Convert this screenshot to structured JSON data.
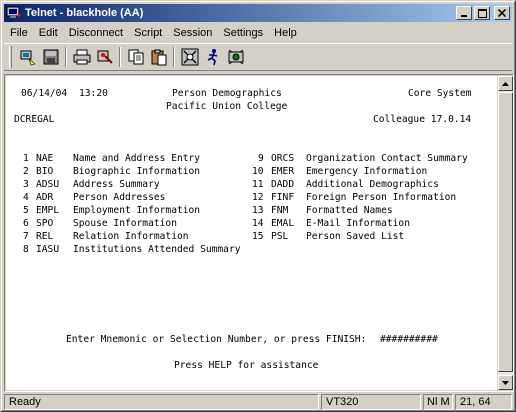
{
  "window": {
    "title": "Telnet - blackhole (AA)"
  },
  "menu": [
    "File",
    "Edit",
    "Disconnect",
    "Script",
    "Session",
    "Settings",
    "Help"
  ],
  "toolbar": {
    "icons": [
      "connect-icon",
      "save-icon",
      "print-icon",
      "color-icon",
      "copy-icon",
      "paste-icon",
      "network-icon",
      "run-icon",
      "macro-icon"
    ]
  },
  "terminal": {
    "header": {
      "date": "06/14/04",
      "time": "13:20",
      "title": "Person Demographics",
      "institution": "Pacific Union College",
      "system": "Core System",
      "screen_code": "DCREGAL",
      "version": "Colleague 17.0.14"
    },
    "options_left": [
      {
        "num": "1",
        "code": "NAE",
        "label": "Name and Address Entry"
      },
      {
        "num": "2",
        "code": "BIO",
        "label": "Biographic Information"
      },
      {
        "num": "3",
        "code": "ADSU",
        "label": "Address Summary"
      },
      {
        "num": "4",
        "code": "ADR",
        "label": "Person Addresses"
      },
      {
        "num": "5",
        "code": "EMPL",
        "label": "Employment Information"
      },
      {
        "num": "6",
        "code": "SPO",
        "label": "Spouse Information"
      },
      {
        "num": "7",
        "code": "REL",
        "label": "Relation Information"
      },
      {
        "num": "8",
        "code": "IASU",
        "label": "Institutions Attended Summary"
      }
    ],
    "options_right": [
      {
        "num": "9",
        "code": "ORCS",
        "label": "Organization Contact Summary"
      },
      {
        "num": "10",
        "code": "EMER",
        "label": "Emergency Information"
      },
      {
        "num": "11",
        "code": "DADD",
        "label": "Additional Demographics"
      },
      {
        "num": "12",
        "code": "FINF",
        "label": "Foreign Person Information"
      },
      {
        "num": "13",
        "code": "FNM",
        "label": "Formatted Names"
      },
      {
        "num": "14",
        "code": "EMAL",
        "label": "E-Mail Information"
      },
      {
        "num": "15",
        "code": "PSL",
        "label": "Person Saved List"
      }
    ],
    "prompt": "Enter Mnemonic or Selection Number, or press FINISH:",
    "input_value": "##########",
    "help": "Press HELP for assistance"
  },
  "status": {
    "ready": "Ready",
    "terminal_type": "VT320",
    "mode": "Nl M",
    "cursor": "21, 64"
  }
}
